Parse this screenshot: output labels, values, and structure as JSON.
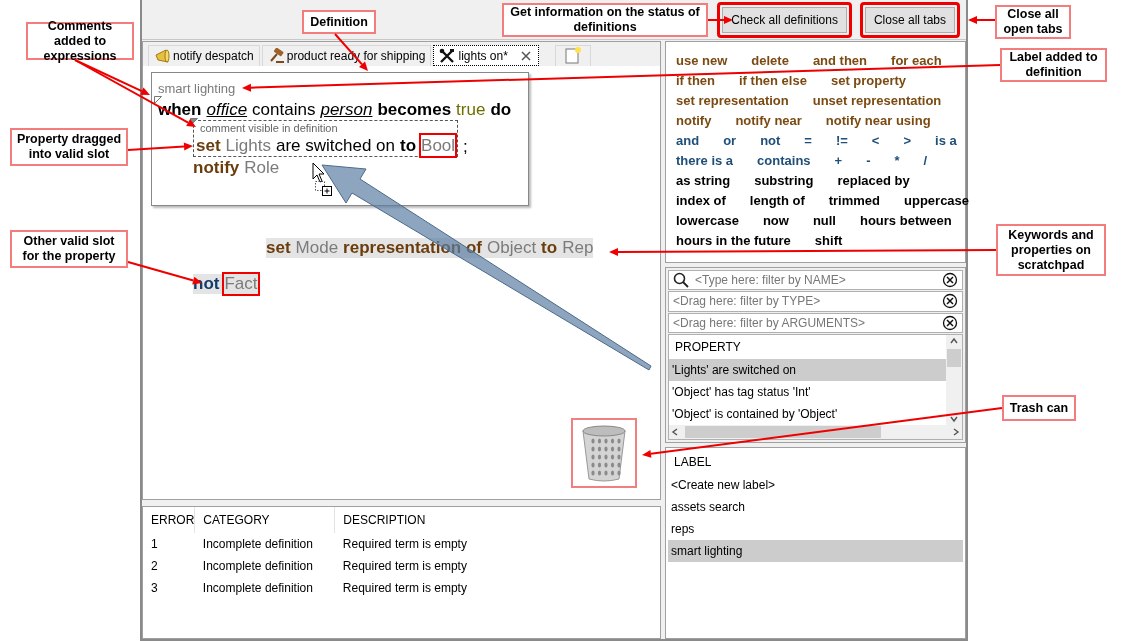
{
  "toolbar": {
    "buttons": [
      {
        "label": "Check all definitions",
        "highlighted": true
      },
      {
        "label": "Close all tabs",
        "highlighted": true
      }
    ]
  },
  "tabs": [
    {
      "label": "notify despatch",
      "kind": "horn",
      "selected": false,
      "closable": false
    },
    {
      "label": "product ready for shipping",
      "kind": "gavel",
      "selected": false,
      "closable": false
    },
    {
      "label": "lights on*",
      "kind": "tools",
      "selected": true,
      "closable": true
    }
  ],
  "definition": {
    "label": "smart lighting",
    "lines": [
      {
        "comment_marker": true,
        "tokens": [
          {
            "text": "when",
            "kind": "keyword",
            "highlighted": false
          },
          {
            "text": "office",
            "kind": "variable",
            "highlighted": false
          },
          {
            "text": "contains",
            "kind": "text",
            "highlighted": false
          },
          {
            "text": "person",
            "kind": "variable",
            "highlighted": false
          },
          {
            "text": "becomes",
            "kind": "keyword",
            "highlighted": false
          },
          {
            "text": "true",
            "kind": "literal",
            "highlighted": false
          },
          {
            "text": "do",
            "kind": "keyword",
            "highlighted": false
          }
        ],
        "children": [
          {
            "comment_marker": true,
            "comment": "comment visible in definition",
            "tokens": [
              {
                "text": "set",
                "kind": "action",
                "highlighted": false
              },
              {
                "text": "Lights",
                "kind": "slot",
                "highlighted": false
              },
              {
                "text": "are switched on",
                "kind": "text",
                "highlighted": false
              },
              {
                "text": "to",
                "kind": "keyword",
                "highlighted": false
              },
              {
                "text": "Bool",
                "kind": "slot",
                "highlighted": true
              }
            ],
            "trailing": [
              {
                "text": ";",
                "highlighted": false
              }
            ]
          },
          {
            "comment_marker": false,
            "tokens": [
              {
                "text": "notify",
                "kind": "action",
                "highlighted": false
              },
              {
                "text": "Role",
                "kind": "slot",
                "highlighted": false
              }
            ]
          }
        ]
      }
    ]
  },
  "scratchpad": [
    {
      "tokens": [
        {
          "text": "set",
          "kind": "action",
          "highlighted": false
        },
        {
          "text": "Mode",
          "kind": "slot",
          "highlighted": false
        },
        {
          "text": "representation of",
          "kind": "action",
          "highlighted": false
        },
        {
          "text": "Object",
          "kind": "slot",
          "highlighted": false
        },
        {
          "text": "to",
          "kind": "action",
          "highlighted": false
        },
        {
          "text": "Rep",
          "kind": "slot",
          "highlighted": false
        }
      ]
    },
    {
      "tokens": [
        {
          "text": "not",
          "kind": "operator",
          "highlighted": false
        },
        {
          "text": "Fact",
          "kind": "slot",
          "highlighted": true
        }
      ]
    }
  ],
  "trash": {
    "highlighted": true
  },
  "errors": {
    "columns": [
      "ERROR",
      "CATEGORY",
      "DESCRIPTION"
    ],
    "rows": [
      [
        "1",
        "Incomplete definition",
        "Required term is empty"
      ],
      [
        "2",
        "Incomplete definition",
        "Required term is empty"
      ],
      [
        "3",
        "Incomplete definition",
        "Required term is empty"
      ]
    ]
  },
  "keywords": [
    {
      "kind": "action",
      "words": [
        "use new",
        "delete",
        "and then",
        "for each"
      ]
    },
    {
      "kind": "action",
      "words": [
        "if then",
        "if then else",
        "set property"
      ]
    },
    {
      "kind": "action",
      "words": [
        "set representation",
        "unset representation"
      ]
    },
    {
      "kind": "action",
      "words": [
        "notify",
        "notify near",
        "notify near using"
      ]
    },
    {
      "kind": "operator",
      "words": [
        "and",
        "or",
        "not",
        "=",
        "!=",
        "<",
        ">",
        "is a"
      ]
    },
    {
      "kind": "operator",
      "words": [
        "there is a",
        "contains",
        "+",
        "-",
        "*",
        "/"
      ]
    },
    {
      "kind": "function",
      "words": [
        "as string",
        "substring",
        "replaced by"
      ]
    },
    {
      "kind": "function",
      "words": [
        "index of",
        "length of",
        "trimmed",
        "uppercase"
      ]
    },
    {
      "kind": "function",
      "words": [
        "lowercase",
        "now",
        "null",
        "hours between"
      ]
    },
    {
      "kind": "function",
      "words": [
        "hours in the future",
        "shift"
      ]
    }
  ],
  "filters": [
    {
      "kind": "search",
      "placeholder": "<Type here: filter by NAME>"
    },
    {
      "kind": "drop",
      "placeholder": "<Drag here: filter by TYPE>"
    },
    {
      "kind": "drop",
      "placeholder": "<Drag here: filter by ARGUMENTS>"
    }
  ],
  "properties": {
    "header": "PROPERTY",
    "items": [
      {
        "label": "'Lights' are switched on",
        "selected": true
      },
      {
        "label": "'Object' has tag status 'Int'",
        "selected": false
      },
      {
        "label": "'Object' is contained by 'Object'",
        "selected": false
      }
    ]
  },
  "labels": {
    "header": "LABEL",
    "items": [
      {
        "label": "<Create new label>",
        "selected": false
      },
      {
        "label": "assets search",
        "selected": false
      },
      {
        "label": "reps",
        "selected": false
      },
      {
        "label": "smart lighting",
        "selected": true
      }
    ]
  },
  "callouts": [
    "Comments added to expressions",
    "Definition",
    "Get information on the status of definitions",
    "Close all open tabs",
    "Label added to definition",
    "Property dragged into valid slot",
    "Other valid slot for the property",
    "Keywords and properties on scratchpad",
    "Trash can"
  ]
}
